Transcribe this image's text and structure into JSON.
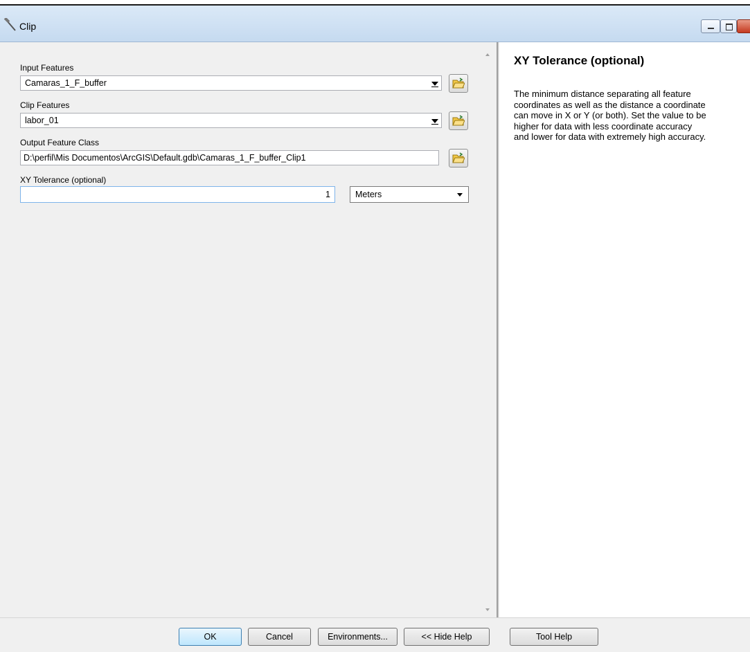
{
  "window": {
    "title": "Clip"
  },
  "form": {
    "input_features": {
      "label": "Input Features",
      "value": "Camaras_1_F_buffer"
    },
    "clip_features": {
      "label": "Clip Features",
      "value": "labor_01"
    },
    "output_feature_class": {
      "label": "Output Feature Class",
      "value": "D:\\perfil\\Mis Documentos\\ArcGIS\\Default.gdb\\Camaras_1_F_buffer_Clip1"
    },
    "xy_tolerance": {
      "label": "XY Tolerance (optional)",
      "value": "1",
      "unit": "Meters"
    }
  },
  "help": {
    "title": "XY Tolerance (optional)",
    "lines": [
      "The minimum distance separating all feature",
      "coordinates as well as the distance a coordinate",
      "can move in X or Y (or both). Set the value to be",
      "higher for data with less coordinate accuracy",
      "and lower for data with extremely high accuracy."
    ]
  },
  "buttons": {
    "ok": "OK",
    "cancel": "Cancel",
    "environments": "Environments...",
    "hide_help": "<< Hide Help",
    "tool_help": "Tool Help"
  },
  "icons": {
    "title": "hammer-icon",
    "browse": "open-folder-icon"
  },
  "colors": {
    "titlebar": "#c5daf0",
    "default_button": "#bee6fd",
    "close_button": "#c4391f"
  }
}
